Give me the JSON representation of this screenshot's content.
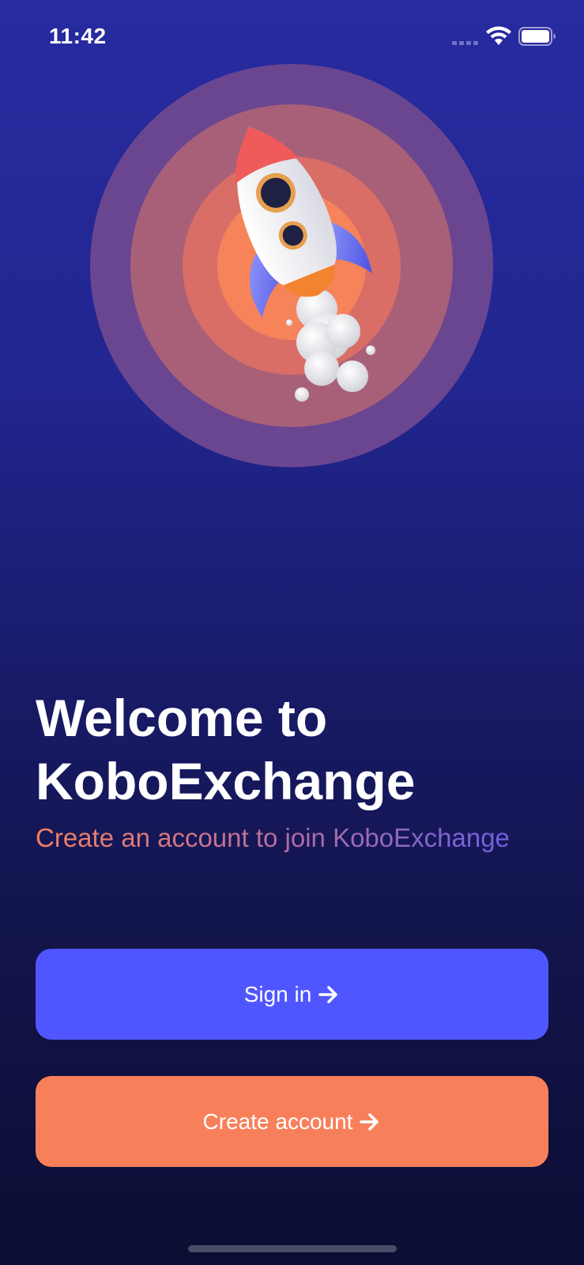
{
  "status_bar": {
    "time": "11:42",
    "wifi_icon": "wifi-icon",
    "battery_icon": "battery-icon",
    "signal_icon": "cellular-signal-icon"
  },
  "hero": {
    "illustration": "rocket-illustration",
    "ring_colors": [
      "#6b4690",
      "#a86078",
      "#d96e67",
      "#f7835b"
    ]
  },
  "welcome": {
    "title_line1": "Welcome to",
    "title_line2": "KoboExchange",
    "subtitle": "Create an account to join KoboExchange"
  },
  "actions": {
    "signin_label": "Sign in",
    "signin_icon": "arrow-right-icon",
    "create_label": "Create account",
    "create_icon": "arrow-right-icon"
  },
  "colors": {
    "primary": "#5056ff",
    "accent": "#f7805b",
    "background_top": "#272ba0",
    "background_bottom": "#0c0d33"
  }
}
